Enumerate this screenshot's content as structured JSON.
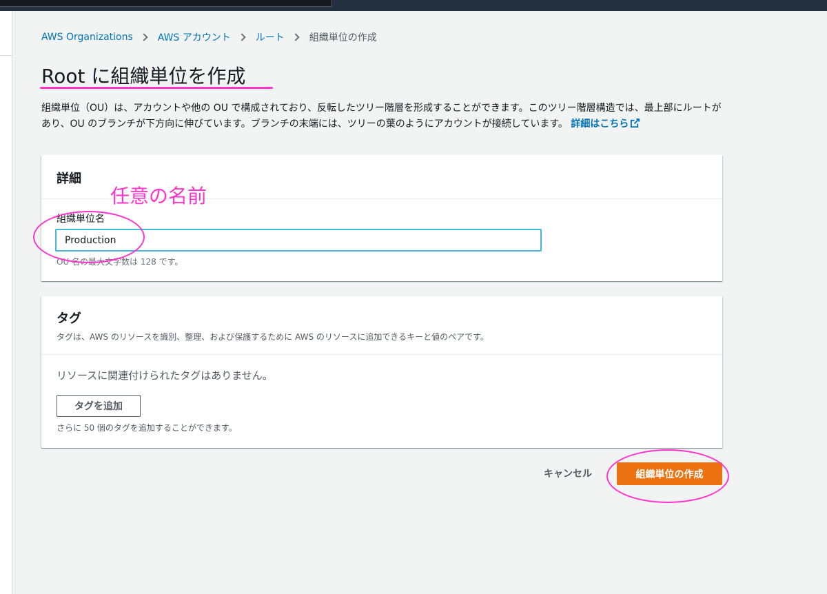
{
  "breadcrumb": {
    "items": [
      "AWS Organizations",
      "AWS アカウント",
      "ルート"
    ],
    "current": "組織単位の作成"
  },
  "page": {
    "title": "Root に組織単位を作成",
    "description": "組織単位（OU）は、アカウントや他の OU で構成されており、反転したツリー階層を形成することができます。このツリー階層構造では、最上部にルートがあり、OU のブランチが下方向に伸びています。ブランチの末端には、ツリーの葉のようにアカウントが接続しています。",
    "learn_more": "詳細はこちら"
  },
  "details": {
    "heading": "詳細",
    "name_label": "組織単位名",
    "name_value": "Production",
    "name_hint": "OU 名の最大文字数は 128 です。"
  },
  "annotation": {
    "name_note": "任意の名前",
    "color": "#ff33cc"
  },
  "tags": {
    "heading": "タグ",
    "description": "タグは、AWS のリソースを識別、整理、および保護するために AWS のリソースに追加できるキーと値のペアです。",
    "empty": "リソースに関連付けられたタグはありません。",
    "add_button": "タグを追加",
    "hint": "さらに 50 個のタグを追加することができます。"
  },
  "actions": {
    "cancel": "キャンセル",
    "create": "組織単位の作成"
  },
  "colors": {
    "primary": "#ec7211",
    "link": "#0073bb",
    "focus": "#44b9d6"
  }
}
